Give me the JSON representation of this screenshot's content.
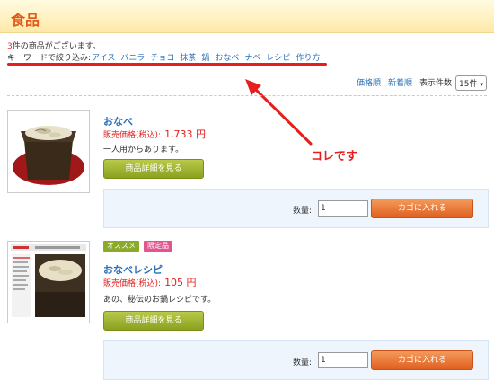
{
  "header": {
    "title": "食品"
  },
  "results": {
    "count": "3",
    "count_suffix": "件の商品がございます。"
  },
  "keywords": {
    "prefix": "キーワードで絞り込み:",
    "items": [
      "アイス",
      "バニラ",
      "チョコ",
      "抹茶",
      "鍋",
      "おなべ",
      "ナベ",
      "レシピ",
      "作り方"
    ]
  },
  "sort": {
    "price_order": "価格順",
    "new_order": "新着順",
    "per_page_label": "表示件数",
    "per_page_value": "15件"
  },
  "annotation": {
    "callout": "コレです"
  },
  "products": [
    {
      "name": "おなべ",
      "price_label": "販売価格(税込):",
      "price_value": "1,733 円",
      "description": "一人用からあります。",
      "detail_button": "商品詳細を見る",
      "qty_label": "数量:",
      "qty_value": "1",
      "cart_button": "カゴに入れる"
    },
    {
      "badges": [
        "オススメ",
        "限定品"
      ],
      "name": "おなべレシピ",
      "price_label": "販売価格(税込):",
      "price_value": "105 円",
      "description": "あの、秘伝のお鍋レシピです。",
      "detail_button": "商品詳細を見る",
      "qty_label": "数量:",
      "qty_value": "1",
      "cart_button": "カゴに入れる"
    }
  ],
  "colors": {
    "accent_orange": "#e05a1a",
    "link_blue": "#2a6fb8",
    "price_red": "#e02020",
    "annotation_red": "#e61e1e",
    "detail_green": "#8aa11e",
    "cart_orange": "#e06020"
  }
}
